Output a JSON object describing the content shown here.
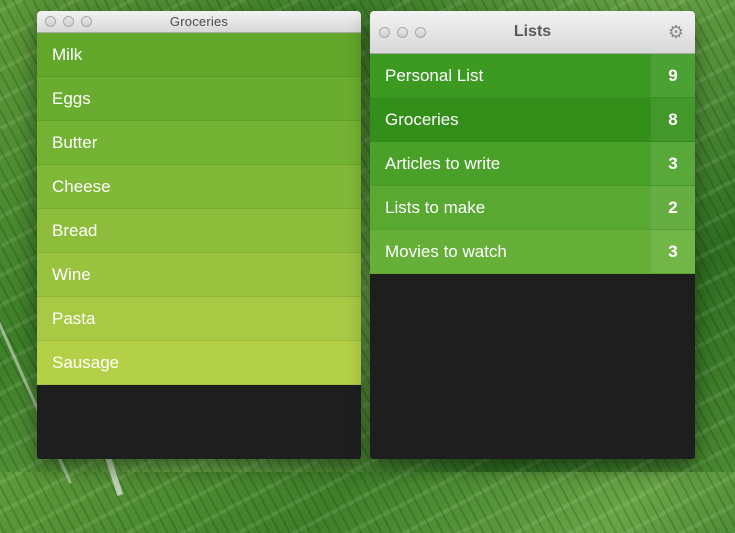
{
  "groceries_window": {
    "title": "Groceries",
    "items": [
      {
        "label": "Milk",
        "color": "#62a62a"
      },
      {
        "label": "Eggs",
        "color": "#6aac2f"
      },
      {
        "label": "Butter",
        "color": "#74b233"
      },
      {
        "label": "Cheese",
        "color": "#80b837"
      },
      {
        "label": "Bread",
        "color": "#8dbd3b"
      },
      {
        "label": "Wine",
        "color": "#99c23f"
      },
      {
        "label": "Pasta",
        "color": "#a7c943"
      },
      {
        "label": "Sausage",
        "color": "#b4d047"
      }
    ]
  },
  "lists_window": {
    "title": "Lists",
    "items": [
      {
        "label": "Personal List",
        "count": "9",
        "color": "#3c9a22"
      },
      {
        "label": "Groceries",
        "count": "8",
        "color": "#338f19"
      },
      {
        "label": "Articles to write",
        "count": "3",
        "color": "#4aa12a"
      },
      {
        "label": "Lists to make",
        "count": "2",
        "color": "#59a831"
      },
      {
        "label": "Movies to watch",
        "count": "3",
        "color": "#66b039"
      }
    ]
  }
}
